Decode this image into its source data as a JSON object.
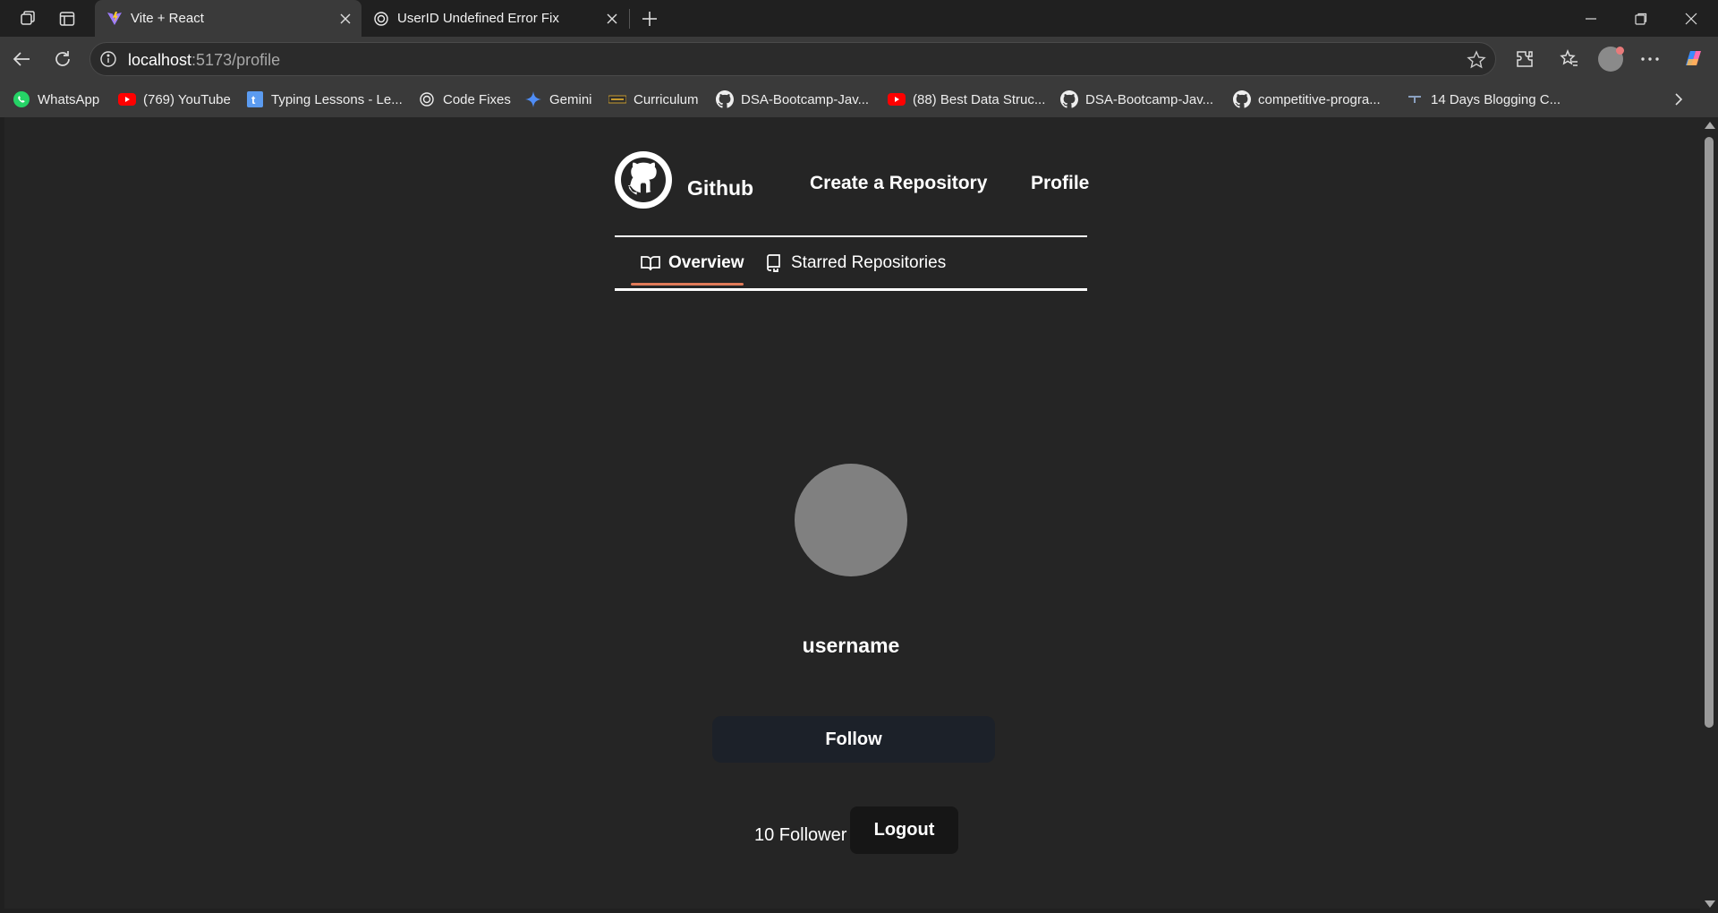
{
  "browser": {
    "tabs": [
      {
        "title": "Vite + React",
        "active": true
      },
      {
        "title": "UserID Undefined Error Fix",
        "active": false
      }
    ],
    "address": {
      "host": "localhost",
      "path": ":5173/profile"
    },
    "bookmarks": [
      {
        "label": "WhatsApp",
        "icon": "whatsapp-icon"
      },
      {
        "label": "(769) YouTube",
        "icon": "youtube-icon"
      },
      {
        "label": "Typing Lessons - Le...",
        "icon": "typing-icon"
      },
      {
        "label": "Code Fixes",
        "icon": "chatgpt-icon"
      },
      {
        "label": "Gemini",
        "icon": "gemini-icon"
      },
      {
        "label": "Curriculum",
        "icon": "curriculum-icon"
      },
      {
        "label": "DSA-Bootcamp-Jav...",
        "icon": "github-icon"
      },
      {
        "label": "(88) Best Data Struc...",
        "icon": "youtube-icon"
      },
      {
        "label": "DSA-Bootcamp-Jav...",
        "icon": "github-icon"
      },
      {
        "label": "competitive-progra...",
        "icon": "github-icon"
      },
      {
        "label": "14 Days Blogging C...",
        "icon": "blog-icon"
      }
    ]
  },
  "nav": {
    "brand": "Github",
    "create": "Create a Repository",
    "profile": "Profile"
  },
  "profile_tabs": {
    "overview": "Overview",
    "starred": "Starred Repositories"
  },
  "profile": {
    "username": "username",
    "follow_label": "Follow",
    "followers": "10 Follower",
    "logout_label": "Logout"
  },
  "colors": {
    "page_bg": "#252525",
    "tab_accent": "#e07a58",
    "follow_bg": "#1c2129"
  }
}
